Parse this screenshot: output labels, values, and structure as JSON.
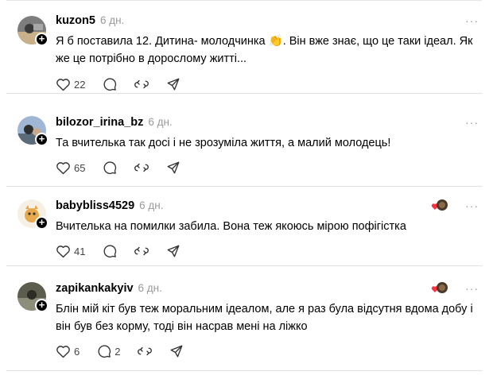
{
  "posts": [
    {
      "username": "kuzon5",
      "time": "6 дн.",
      "text_lines": [
        "Я б поставила 12. Дитина- молодчинка 👏. Він вже знає, що це таки ідеал. Як",
        "же це потрібно в дорослому житті..."
      ],
      "likes": "22",
      "replies": "",
      "liked_by_icon": false,
      "avatar_colors": [
        "#6b6b6b",
        "#c9b08a"
      ]
    },
    {
      "username": "bilozor_irina_bz",
      "time": "6 дн.",
      "text_lines": [
        "Та вчителька так досі і не зрозуміла життя, а малий молодець!"
      ],
      "likes": "65",
      "replies": "",
      "liked_by_icon": false,
      "avatar_colors": [
        "#8ea7c8",
        "#3c3c3c"
      ]
    },
    {
      "username": "babybliss4529",
      "time": "6 дн.",
      "text_lines": [
        "Вчителька на помилки забила. Вона теж якоюсь мірою пофігістка"
      ],
      "likes": "41",
      "replies": "",
      "liked_by_icon": true,
      "avatar_colors": [
        "#f5efe4",
        "#e2a24a"
      ]
    },
    {
      "username": "zapikankakyiv",
      "time": "6 дн.",
      "text_lines": [
        "Блін мій кіт був теж моральним ідеалом, але я раз була відсутня вдома добу і",
        "він був без корму, тоді він насрав мені на ліжко"
      ],
      "likes": "6",
      "replies": "2",
      "liked_by_icon": true,
      "avatar_colors": [
        "#5a5a4a",
        "#9a9a8a"
      ]
    }
  ],
  "icons": {
    "more": "more-icon",
    "like": "heart-icon",
    "reply": "comment-icon",
    "repost": "repost-icon",
    "share": "send-icon"
  },
  "colors": {
    "like_red": "#ff3040",
    "muted": "#999999"
  }
}
